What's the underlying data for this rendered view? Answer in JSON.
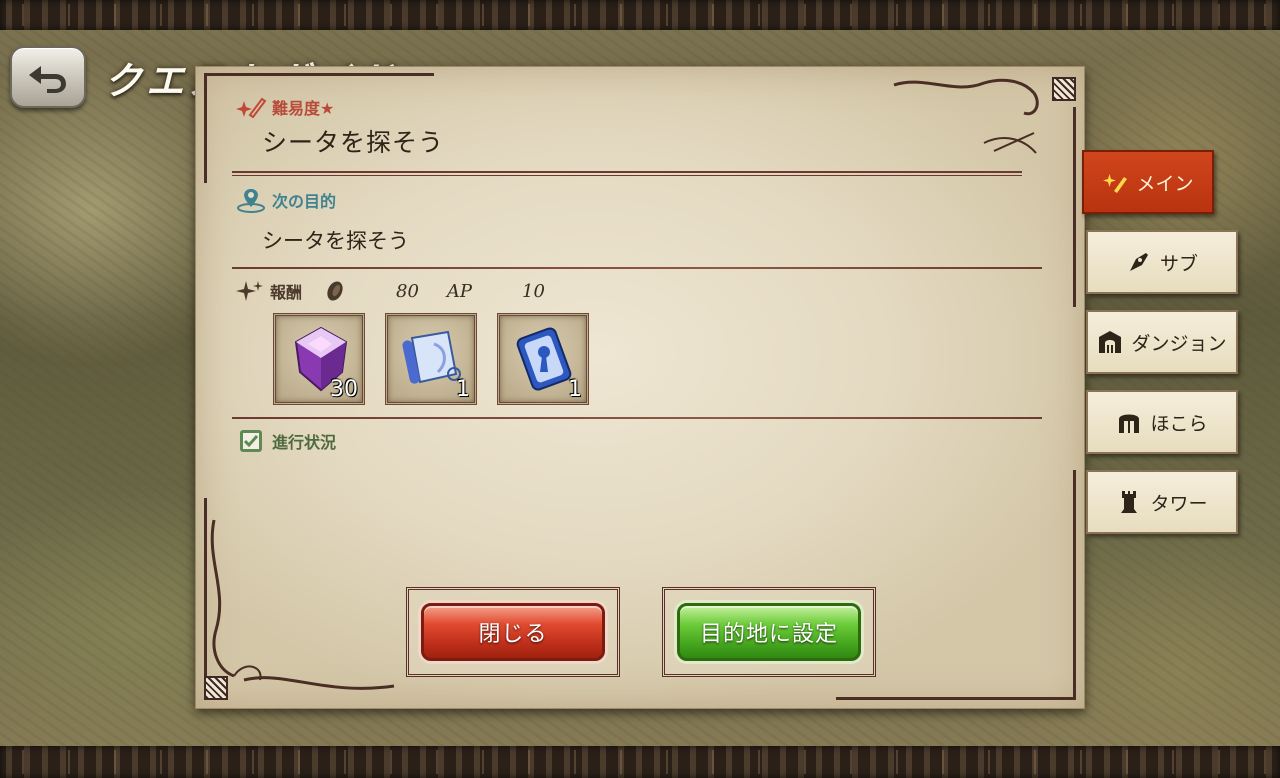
{
  "header": {
    "title": "クエストガイド"
  },
  "panel": {
    "difficulty_label": "難易度★",
    "quest_title": "シータを探そう",
    "objective_label": "次の目的",
    "objective_text": "シータを探そう",
    "reward_label": "報酬",
    "reward_coin_value": "80",
    "reward_ap_label": "AP",
    "reward_ap_value": "10",
    "items": [
      {
        "icon": "purple-crystal-icon",
        "count": "30"
      },
      {
        "icon": "scroll-icon",
        "count": "1"
      },
      {
        "icon": "key-card-icon",
        "count": "1"
      }
    ],
    "progress_label": "進行状況",
    "close_label": "閉じる",
    "set_destination_label": "目的地に設定"
  },
  "tabs": [
    {
      "label": "メイン",
      "icon": "sparkle-pen-icon",
      "active": true
    },
    {
      "label": "サブ",
      "icon": "pen-nib-icon",
      "active": false
    },
    {
      "label": "ダンジョン",
      "icon": "gate-icon",
      "active": false
    },
    {
      "label": "ほこら",
      "icon": "shrine-icon",
      "active": false
    },
    {
      "label": "タワー",
      "icon": "tower-icon",
      "active": false
    }
  ],
  "colors": {
    "difficulty": "#b84a3a",
    "objective": "#3f8290",
    "active_tab": "#c23e16",
    "close_button": "#d63c24",
    "confirm_button": "#5cbc2c"
  }
}
